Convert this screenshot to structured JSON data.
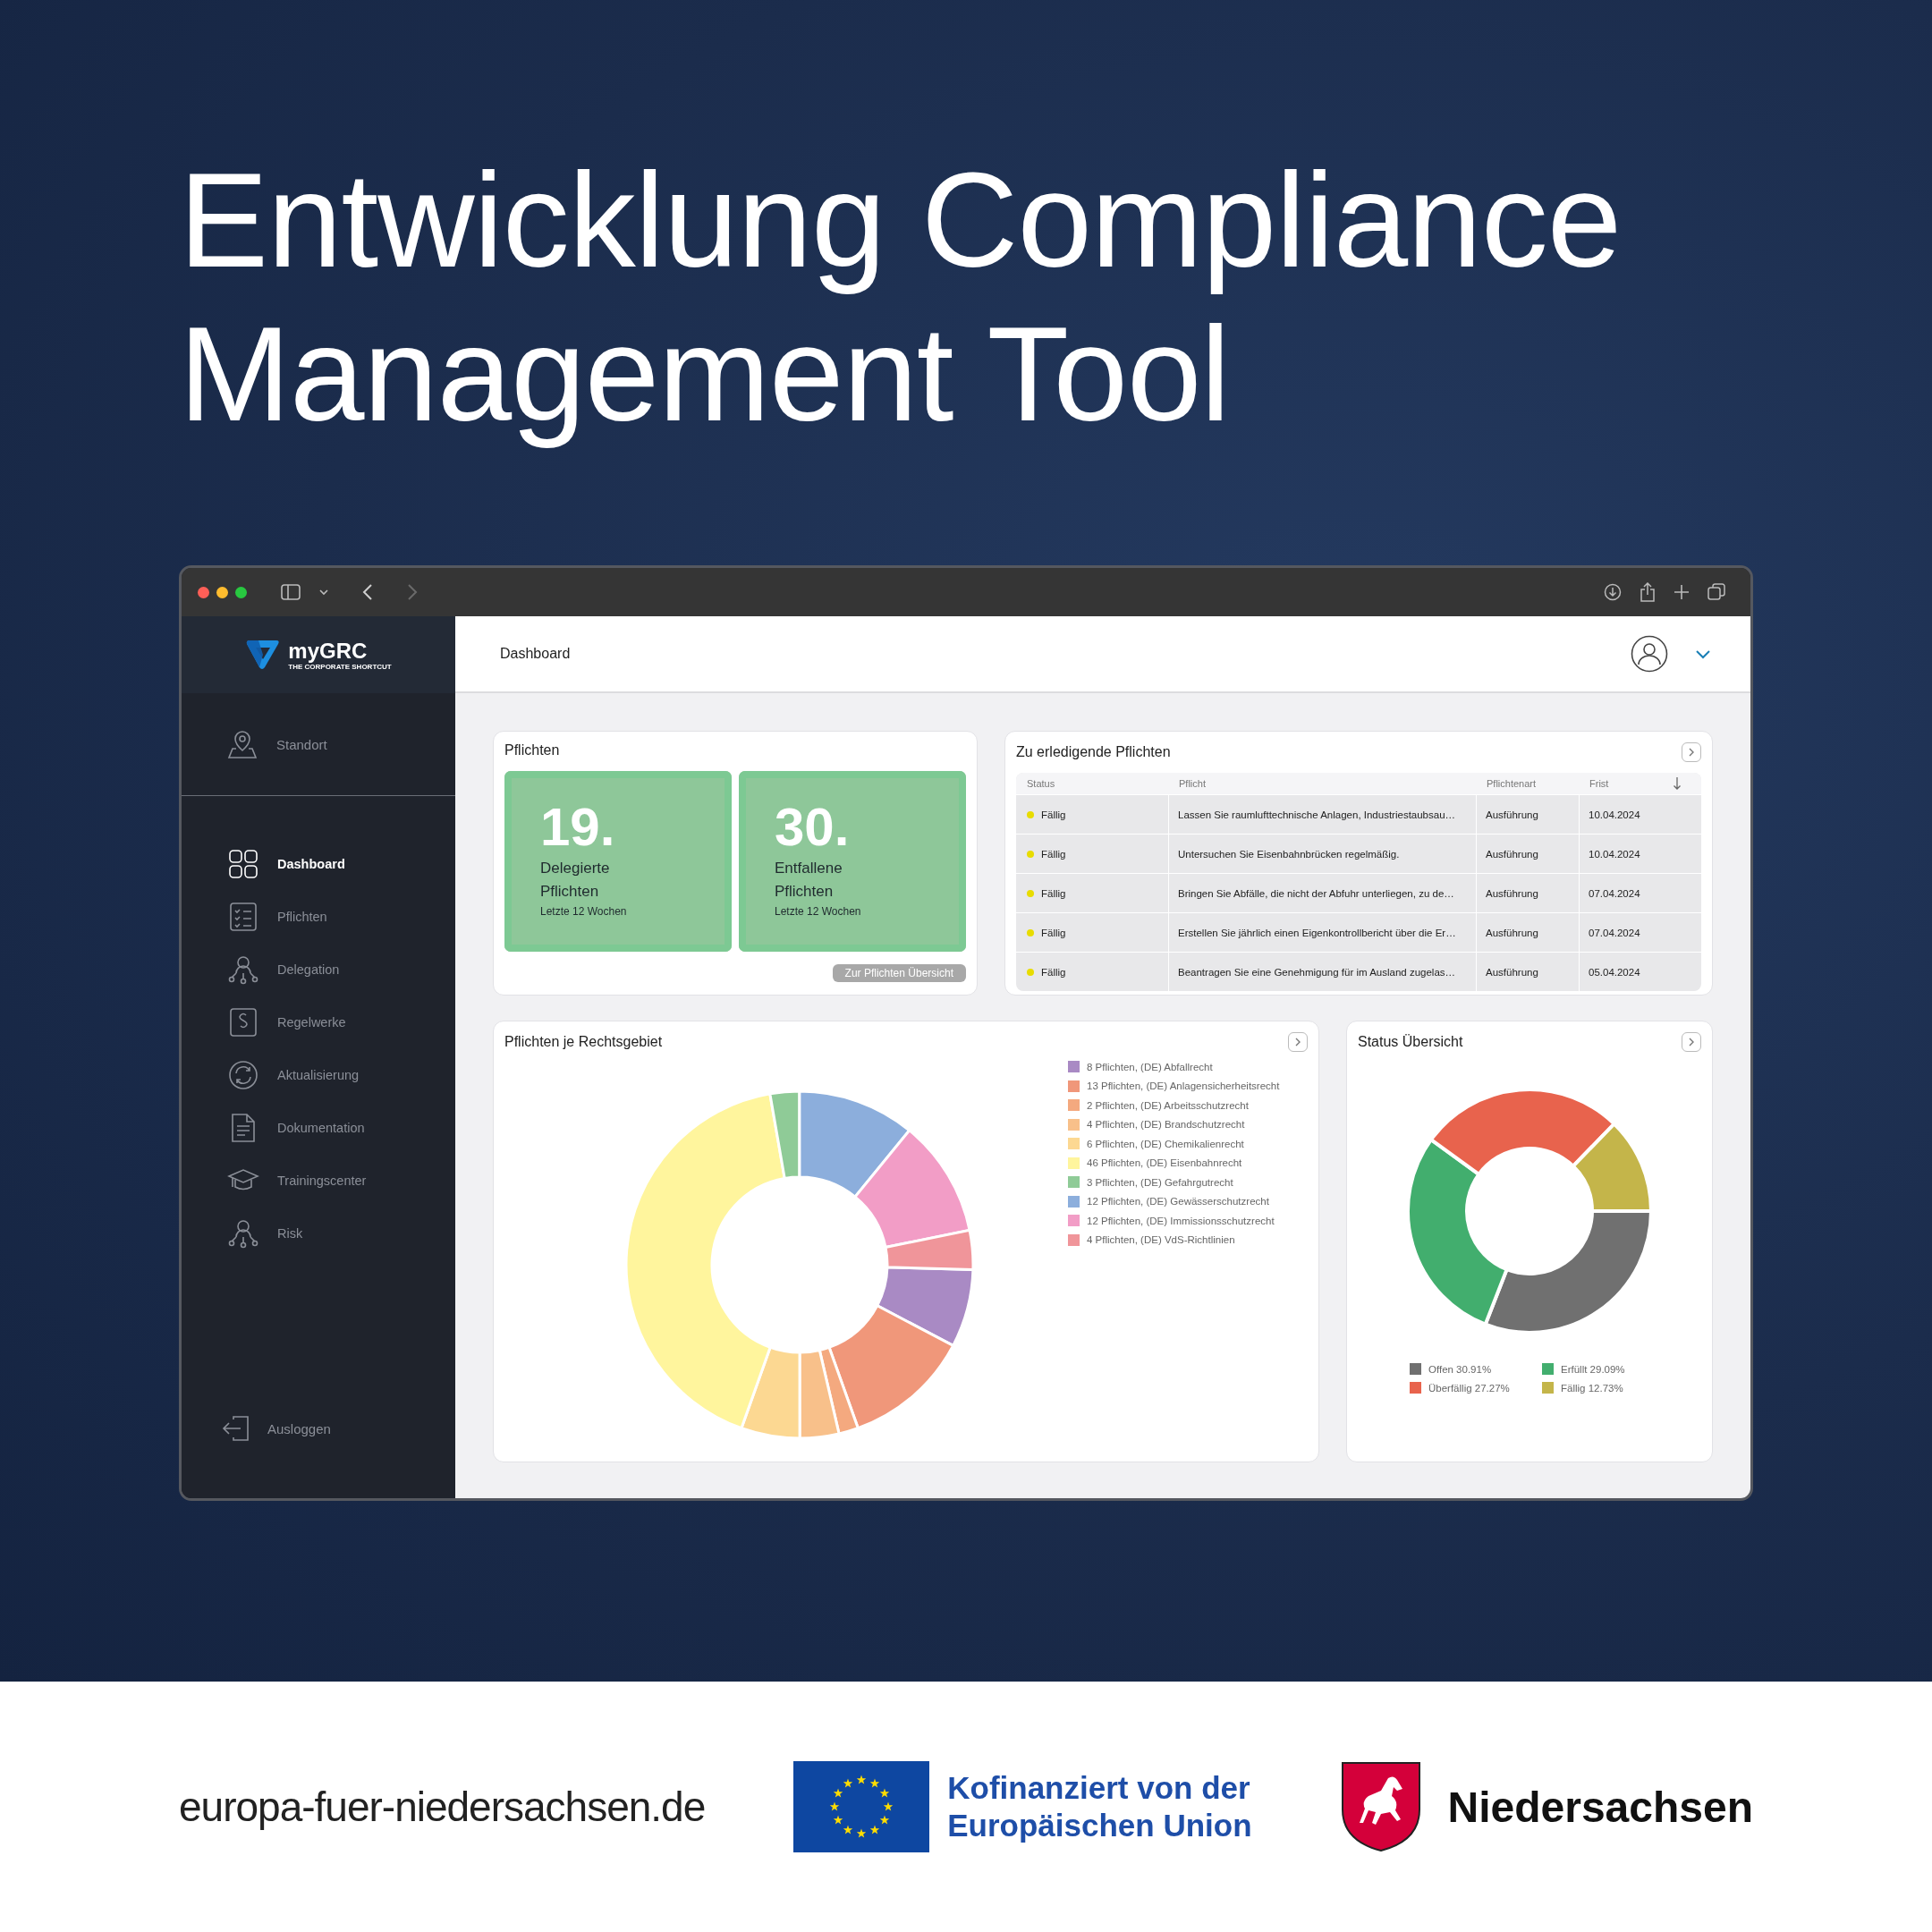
{
  "headline": [
    "Entwicklung Compliance",
    "Management Tool"
  ],
  "browser": {
    "back_enabled": true,
    "forward_enabled": false
  },
  "app": {
    "logo": {
      "name": "myGRC",
      "tagline": "THE CORPORATE SHORTCUT"
    },
    "location": "Standort",
    "nav": [
      {
        "label": "Dashboard",
        "selected": true
      },
      {
        "label": "Pflichten",
        "selected": false
      },
      {
        "label": "Delegation",
        "selected": false
      },
      {
        "label": "Regelwerke",
        "selected": false
      },
      {
        "label": "Aktualisierung",
        "selected": false
      },
      {
        "label": "Dokumentation",
        "selected": false
      },
      {
        "label": "Trainingscenter",
        "selected": false
      },
      {
        "label": "Risk",
        "selected": false
      }
    ],
    "logout": "Ausloggen",
    "page_title": "Dashboard"
  },
  "duties_card": {
    "title": "Pflichten",
    "tiles": [
      {
        "number": "19.",
        "label": "Delegierte Pflichten",
        "period": "Letzte 12 Wochen"
      },
      {
        "number": "30.",
        "label": "Entfallene Pflichten",
        "period": "Letzte 12 Wochen"
      }
    ],
    "button": "Zur Pflichten Übersicht"
  },
  "todo_card": {
    "title": "Zu erledigende Pflichten",
    "columns": [
      "Status",
      "Pflicht",
      "Pflichtenart",
      "Frist"
    ],
    "rows": [
      {
        "status": "Fällig",
        "duty": "Lassen Sie raumlufttechnische Anlagen, Industriestaubsau…",
        "type": "Ausführung",
        "deadline": "10.04.2024"
      },
      {
        "status": "Fällig",
        "duty": "Untersuchen Sie Eisenbahnbrücken regelmäßig.",
        "type": "Ausführung",
        "deadline": "10.04.2024"
      },
      {
        "status": "Fällig",
        "duty": "Bringen Sie Abfälle, die nicht der Abfuhr unterliegen, zu de…",
        "type": "Ausführung",
        "deadline": "07.04.2024"
      },
      {
        "status": "Fällig",
        "duty": "Erstellen Sie jährlich einen Eigenkontrollbericht über die Er…",
        "type": "Ausführung",
        "deadline": "07.04.2024"
      },
      {
        "status": "Fällig",
        "duty": "Beantragen Sie eine Genehmigung für im Ausland zugelas…",
        "type": "Ausführung",
        "deadline": "05.04.2024"
      }
    ]
  },
  "area_card": {
    "title": "Pflichten je Rechtsgebiet",
    "legend": [
      {
        "color": "#a98ac4"
      },
      {
        "color": "#f0977a"
      },
      {
        "color": "#f4a97f"
      },
      {
        "color": "#f8c08a"
      },
      {
        "color": "#fcd892"
      },
      {
        "color": "#fff59d"
      },
      {
        "color": "#8fcb97"
      },
      {
        "color": "#8caedc"
      },
      {
        "color": "#f29dc6"
      },
      {
        "color": "#f0959a"
      }
    ],
    "chart_data": {
      "type": "donut",
      "categories": [
        "8 Pflichten, (DE) Abfallrecht",
        "13 Pflichten, (DE) Anlagensicherheitsrecht",
        "2 Pflichten, (DE) Arbeitsschutzrecht",
        "4 Pflichten, (DE) Brandschutzrecht",
        "6 Pflichten, (DE) Chemikalienrecht",
        "46 Pflichten, (DE) Eisenbahnrecht",
        "3 Pflichten, (DE) Gefahrgutrecht",
        "12 Pflichten, (DE) Gewässerschutzrecht",
        "12 Pflichten, (DE) Immissionsschutzrecht",
        "4 Pflichten, (DE) VdS-Richtlinien"
      ],
      "values": [
        8,
        13,
        2,
        4,
        6,
        46,
        3,
        12,
        12,
        4
      ]
    }
  },
  "status_card": {
    "title": "Status Übersicht",
    "legend": [
      {
        "color": "#707070"
      },
      {
        "color": "#42ae6e"
      },
      {
        "color": "#e8634d"
      },
      {
        "color": "#c4b54a"
      }
    ],
    "chart_data": {
      "type": "donut",
      "categories": [
        "Offen 30.91%",
        "Erfüllt 29.09%",
        "Überfällig 27.27%",
        "Fällig 12.73%"
      ],
      "values": [
        30.91,
        29.09,
        27.27,
        12.73
      ]
    }
  },
  "footer": {
    "url": "europa-fuer-niedersachsen.de",
    "eu_text": [
      "Kofinanziert von der",
      "Europäischen Union"
    ],
    "state": "Niedersachsen"
  }
}
